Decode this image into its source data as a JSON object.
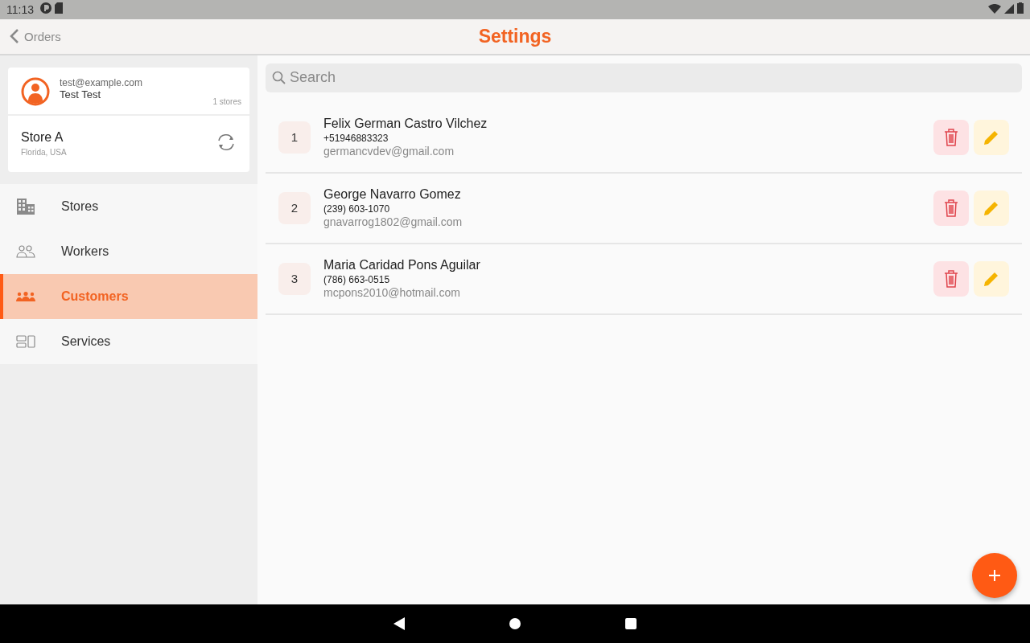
{
  "status_bar": {
    "time": "11:13"
  },
  "header": {
    "back_label": "Orders",
    "title": "Settings"
  },
  "account": {
    "email": "test@example.com",
    "name": "Test Test",
    "store_count": "1 stores"
  },
  "store": {
    "name": "Store A",
    "location": "Florida, USA"
  },
  "sidebar": {
    "items": [
      {
        "label": "Stores",
        "selected": false
      },
      {
        "label": "Workers",
        "selected": false
      },
      {
        "label": "Customers",
        "selected": true
      },
      {
        "label": "Services",
        "selected": false
      }
    ]
  },
  "search": {
    "placeholder": "Search"
  },
  "customers": [
    {
      "number": "1",
      "name": "Felix German Castro Vilchez",
      "phone": "+51946883323",
      "email": "germancvdev@gmail.com"
    },
    {
      "number": "2",
      "name": "George Navarro Gomez",
      "phone": "(239) 603-1070",
      "email": "gnavarrog1802@gmail.com"
    },
    {
      "number": "3",
      "name": "Maria Caridad Pons Aguilar",
      "phone": "(786) 663-0515",
      "email": "mcpons2010@hotmail.com"
    }
  ]
}
